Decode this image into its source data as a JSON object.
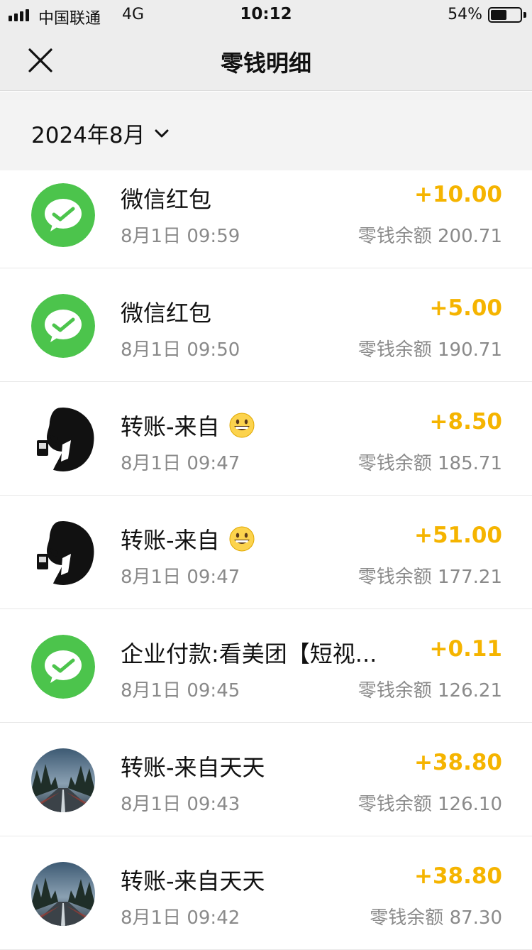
{
  "status_bar": {
    "carrier": "中国联通",
    "network": "4G",
    "time": "10:12",
    "battery_percent_text": "54%",
    "battery_level": 0.54
  },
  "nav": {
    "title": "零钱明细",
    "close_icon": "close-icon"
  },
  "filter": {
    "month_label": "2024年8月",
    "dropdown_icon": "chevron-down-icon"
  },
  "colors": {
    "amount": "#f5b400",
    "wechat_green": "#4cc44c",
    "secondary_text": "#8a8a8a"
  },
  "transactions": [
    {
      "avatar": "wechat-pay-icon",
      "title": "微信红包",
      "time": "8月1日 09:59",
      "amount": "+10.00",
      "balance_label": "零钱余额",
      "balance": "200.71"
    },
    {
      "avatar": "wechat-pay-icon",
      "title": "微信红包",
      "time": "8月1日 09:50",
      "amount": "+5.00",
      "balance_label": "零钱余额",
      "balance": "190.71"
    },
    {
      "avatar": "silhouette-avatar",
      "title": "转账-来自",
      "title_emoji": "grinning-face-emoji",
      "time": "8月1日 09:47",
      "amount": "+8.50",
      "balance_label": "零钱余额",
      "balance": "185.71"
    },
    {
      "avatar": "silhouette-avatar",
      "title": "转账-来自",
      "title_emoji": "grinning-face-emoji",
      "time": "8月1日 09:47",
      "amount": "+51.00",
      "balance_label": "零钱余额",
      "balance": "177.21"
    },
    {
      "avatar": "wechat-pay-icon",
      "title": "企业付款:看美团【短视...",
      "time": "8月1日 09:45",
      "amount": "+0.11",
      "balance_label": "零钱余额",
      "balance": "126.21"
    },
    {
      "avatar": "road-photo-avatar",
      "title": "转账-来自天天",
      "time": "8月1日 09:43",
      "amount": "+38.80",
      "balance_label": "零钱余额",
      "balance": "126.10"
    },
    {
      "avatar": "road-photo-avatar",
      "title": "转账-来自天天",
      "time": "8月1日 09:42",
      "amount": "+38.80",
      "balance_label": "零钱余额",
      "balance": "87.30"
    }
  ]
}
